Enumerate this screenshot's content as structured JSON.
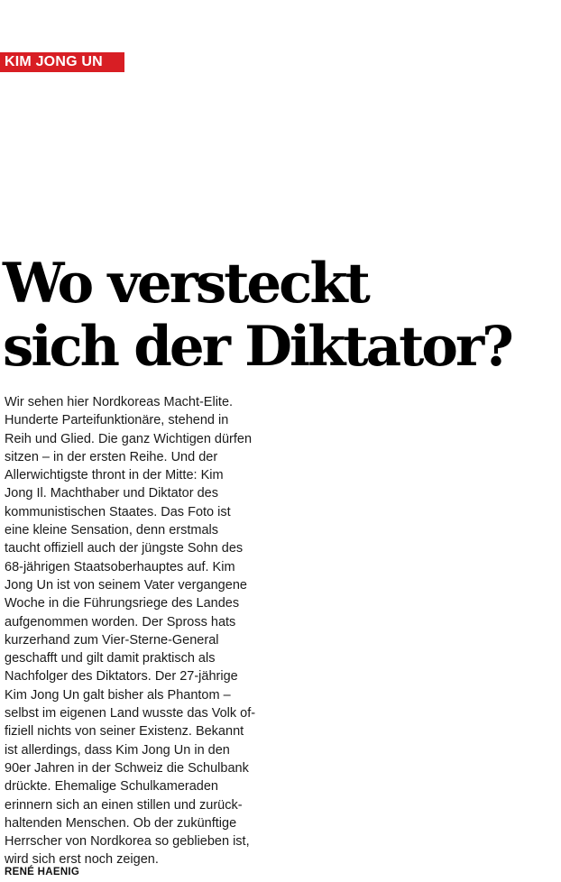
{
  "article": {
    "kicker": "KIM JONG UN",
    "accent_color": "#d81e24",
    "headline_lines": [
      "Wo versteckt",
      "sich der Diktator?"
    ],
    "body_lines": [
      "Wir sehen hier Nordkoreas Macht-Elite.",
      "Hunderte Parteifunktionäre, stehend in",
      "Reih und Glied. Die ganz Wichtigen dürfen",
      "sitzen – in der ersten Reihe. Und der",
      "Allerwichtigste thront in der Mitte: Kim",
      "Jong Il. Machthaber und Diktator des",
      "kommunistischen Staates. Das Foto ist",
      "eine kleine Sensation, denn erstmals",
      "taucht offiziell auch der jüngste Sohn des",
      "68-jährigen Staatsoberhauptes auf. Kim",
      "Jong Un ist von seinem Vater vergangene",
      "Woche in die Führungsriege des Landes",
      "aufgenommen worden. Der Spross hats",
      "kurzerhand zum Vier-Sterne-General",
      "geschafft und gilt damit praktisch als",
      "Nachfolger des Diktators.  Der 27-jährige",
      "Kim Jong Un galt bisher als Phantom –",
      "selbst im eigenen Land wusste das Volk of-",
      "fiziell nichts von seiner Existenz. Bekannt",
      "ist allerdings, dass Kim Jong Un in den",
      "90er Jahren in der Schweiz die Schulbank",
      "drückte. Ehemalige Schulkameraden",
      "erinnern sich an einen stillen und zurück-",
      "haltenden Menschen. Ob der zukünftige",
      "Herrscher von Nordkorea so geblieben ist,",
      "wird sich erst noch zeigen."
    ],
    "byline": "RENÉ HAENIG"
  }
}
